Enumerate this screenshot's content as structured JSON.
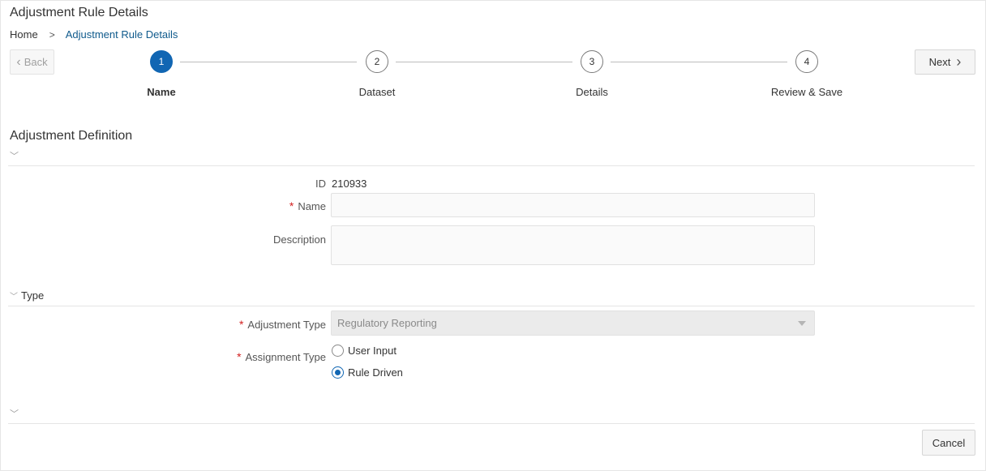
{
  "page": {
    "title": "Adjustment Rule Details"
  },
  "breadcrumb": {
    "home": "Home",
    "separator": ">",
    "current": "Adjustment Rule Details"
  },
  "nav": {
    "back_label": "Back",
    "next_label": "Next"
  },
  "train": {
    "steps": [
      {
        "number": "1",
        "label": "Name",
        "active": true
      },
      {
        "number": "2",
        "label": "Dataset",
        "active": false
      },
      {
        "number": "3",
        "label": "Details",
        "active": false
      },
      {
        "number": "4",
        "label": "Review & Save",
        "active": false
      }
    ]
  },
  "definition": {
    "section_title": "Adjustment Definition",
    "id_label": "ID",
    "id_value": "210933",
    "name_label": "Name",
    "name_value": "",
    "description_label": "Description",
    "description_value": ""
  },
  "type": {
    "section_title": "Type",
    "adjustment_type_label": "Adjustment Type",
    "adjustment_type_value": "Regulatory Reporting",
    "assignment_type_label": "Assignment Type",
    "assignment_options": [
      {
        "label": "User Input",
        "checked": false
      },
      {
        "label": "Rule Driven",
        "checked": true
      }
    ]
  },
  "footer": {
    "cancel_label": "Cancel"
  },
  "colors": {
    "accent": "#1166b3",
    "link": "#0f5a8c",
    "required": "#d21f1f"
  }
}
